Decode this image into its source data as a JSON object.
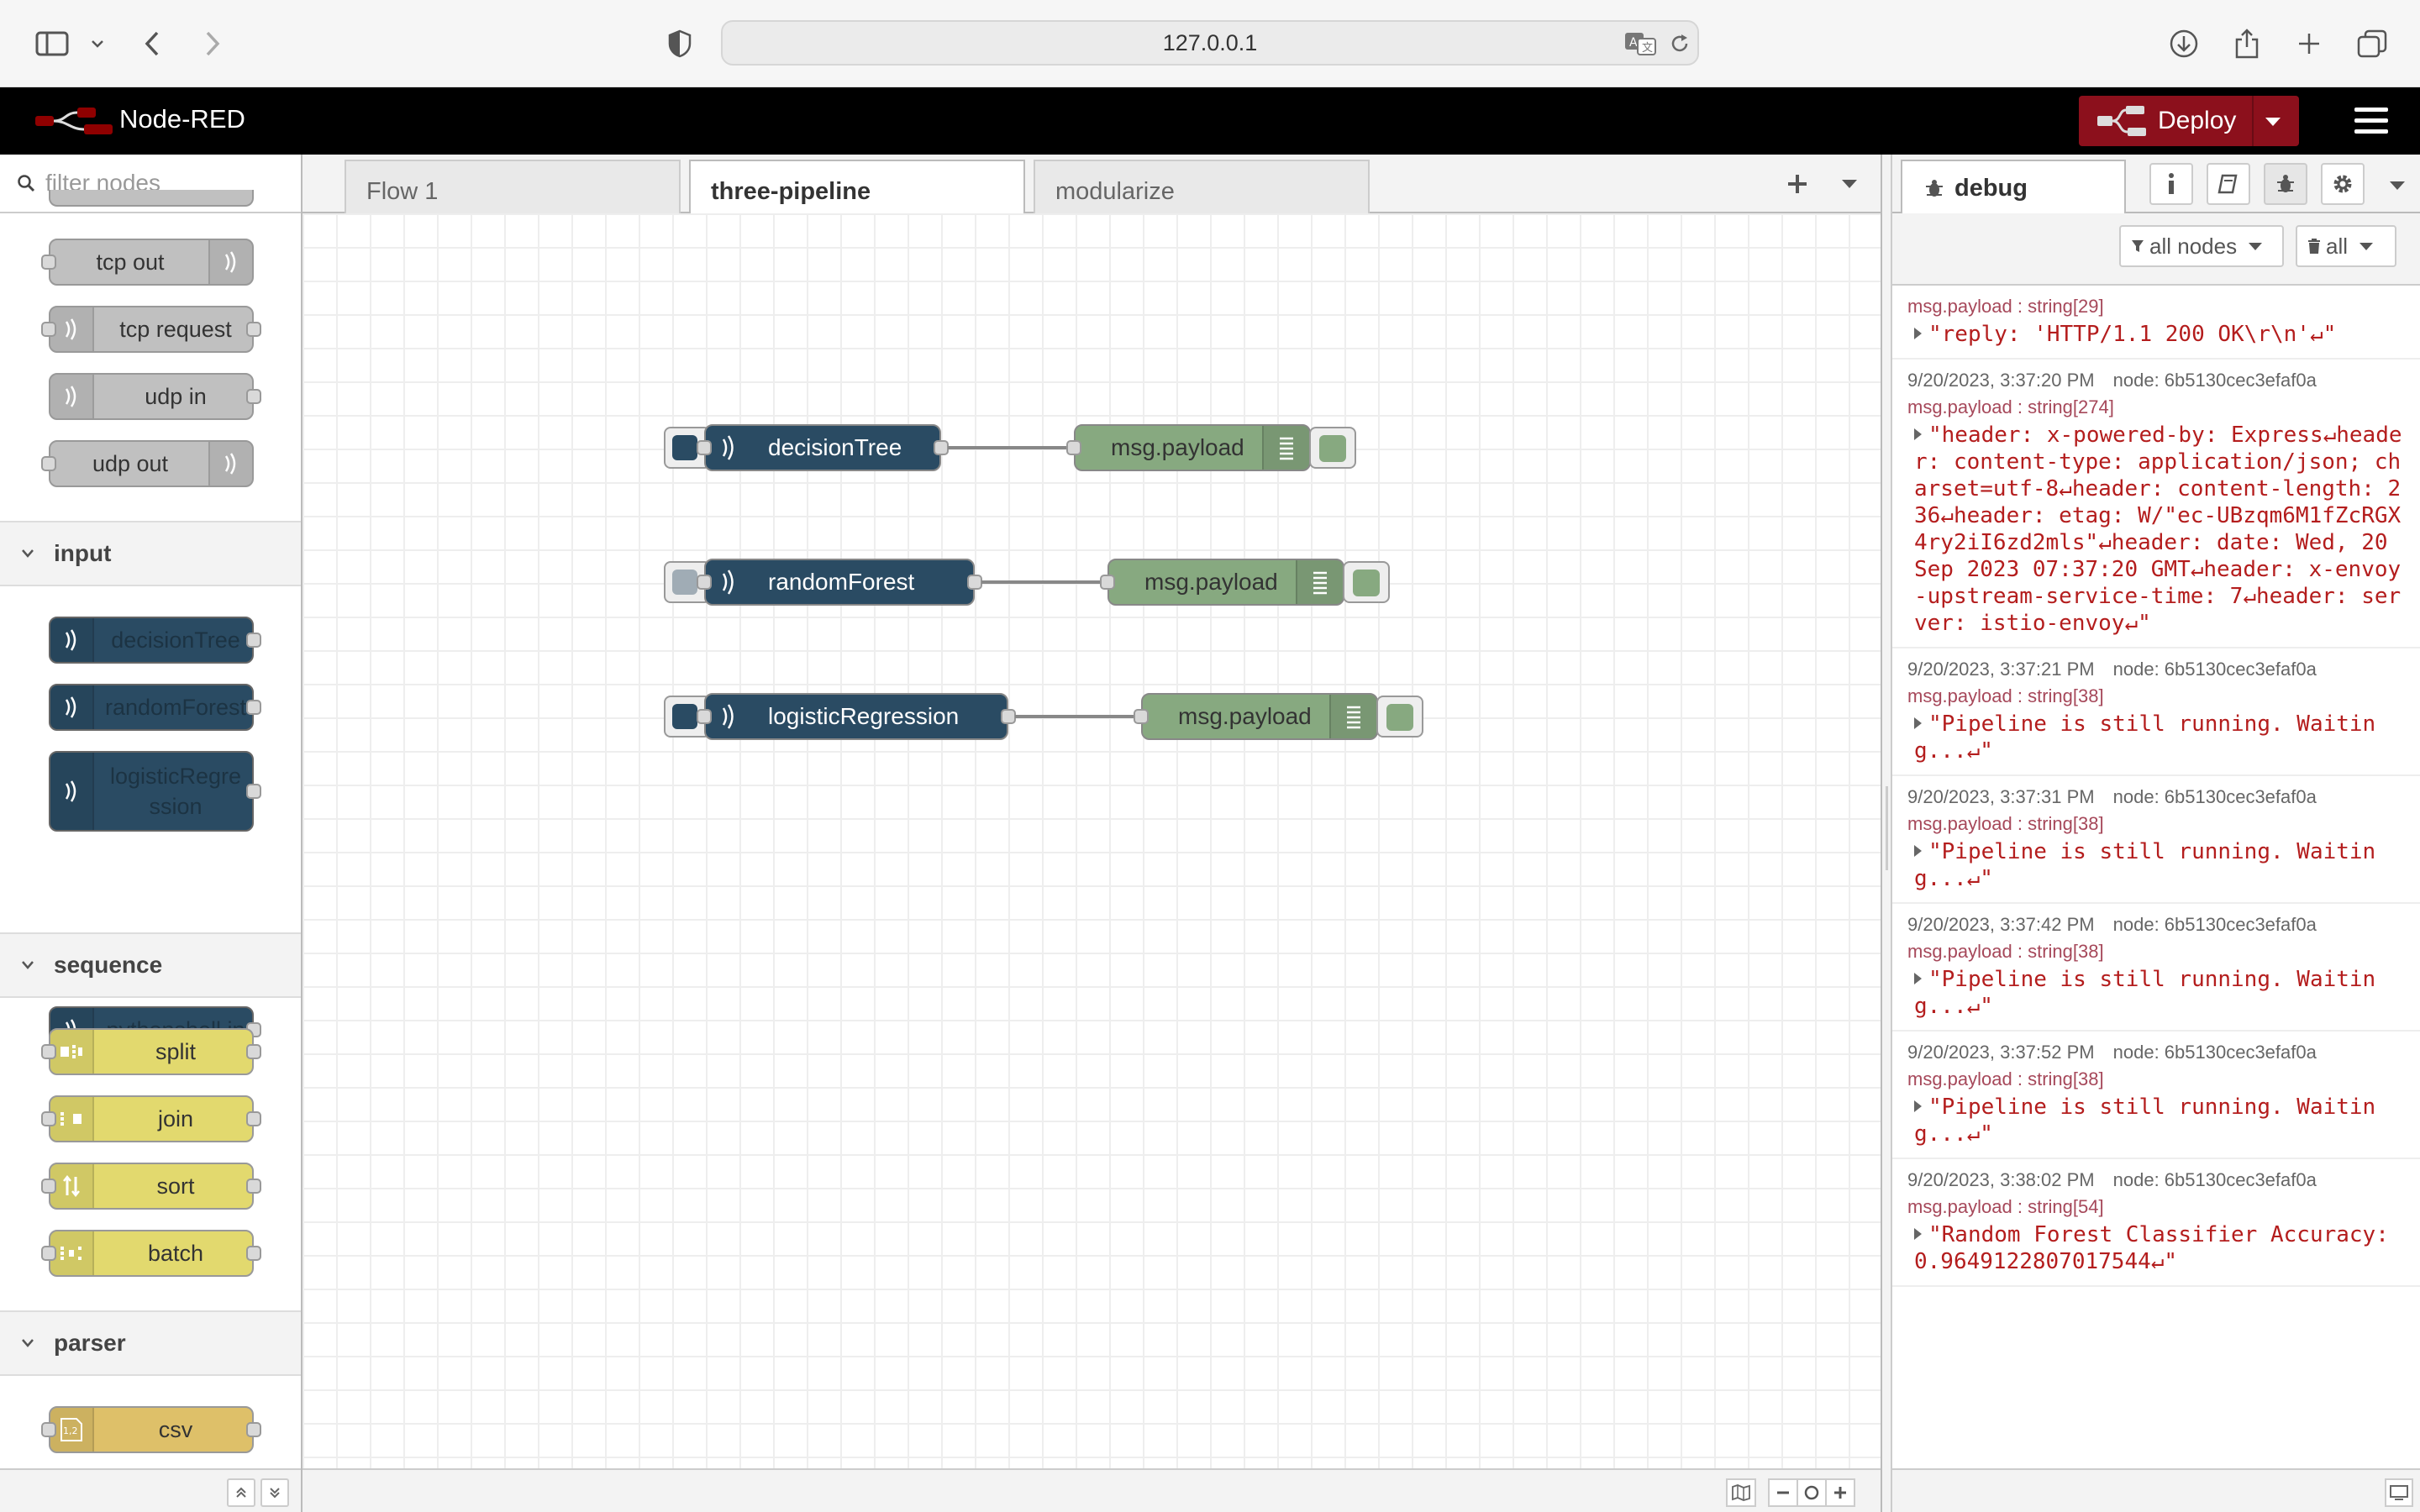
{
  "browser": {
    "url": "127.0.0.1"
  },
  "header": {
    "title": "Node-RED",
    "deploy_label": "Deploy"
  },
  "palette": {
    "search_placeholder": "filter nodes",
    "network_nodes": [
      "tcp out",
      "tcp request",
      "udp in",
      "udp out"
    ],
    "categories": {
      "input": {
        "label": "input",
        "nodes": [
          "decisionTree",
          "randomForest",
          "logisticRegre\nssion",
          "pythonshell in"
        ]
      },
      "sequence": {
        "label": "sequence",
        "nodes": [
          "split",
          "join",
          "sort",
          "batch"
        ]
      },
      "parser": {
        "label": "parser",
        "nodes": [
          "csv"
        ]
      }
    }
  },
  "workspace": {
    "tabs": [
      {
        "label": "Flow 1",
        "active": false
      },
      {
        "label": "three-pipeline",
        "active": true
      },
      {
        "label": "modularize",
        "active": false
      }
    ],
    "flows": [
      {
        "inject": "decisionTree",
        "debug": "msg.payload",
        "inject_active": true
      },
      {
        "inject": "randomForest",
        "debug": "msg.payload",
        "inject_active": false
      },
      {
        "inject": "logisticRegression",
        "debug": "msg.payload",
        "inject_active": true
      }
    ]
  },
  "sidebar": {
    "tab_label": "debug",
    "filter_nodes": "all nodes",
    "clear_label": "all",
    "messages": [
      {
        "meta": "",
        "node": "",
        "topic": "msg.payload : string[29]",
        "body": "\"reply: 'HTTP/1.1 200 OK\\r\\n'↵\""
      },
      {
        "meta": "9/20/2023, 3:37:20 PM",
        "node": "node: 6b5130cec3efaf0a",
        "topic": "msg.payload : string[274]",
        "body": "\"header: x-powered-by: Express↵header: content-type: application/json; charset=utf-8↵header: content-length: 236↵header: etag: W/\"ec-UBzqm6M1fZcRGX4ry2iI6zd2mls\"↵header: date: Wed, 20 Sep 2023 07:37:20 GMT↵header: x-envoy-upstream-service-time: 7↵header: server: istio-envoy↵\""
      },
      {
        "meta": "9/20/2023, 3:37:21 PM",
        "node": "node: 6b5130cec3efaf0a",
        "topic": "msg.payload : string[38]",
        "body": "\"Pipeline is still running. Waiting...↵\""
      },
      {
        "meta": "9/20/2023, 3:37:31 PM",
        "node": "node: 6b5130cec3efaf0a",
        "topic": "msg.payload : string[38]",
        "body": "\"Pipeline is still running. Waiting...↵\""
      },
      {
        "meta": "9/20/2023, 3:37:42 PM",
        "node": "node: 6b5130cec3efaf0a",
        "topic": "msg.payload : string[38]",
        "body": "\"Pipeline is still running. Waiting...↵\""
      },
      {
        "meta": "9/20/2023, 3:37:52 PM",
        "node": "node: 6b5130cec3efaf0a",
        "topic": "msg.payload : string[38]",
        "body": "\"Pipeline is still running. Waiting...↵\""
      },
      {
        "meta": "9/20/2023, 3:38:02 PM",
        "node": "node: 6b5130cec3efaf0a",
        "topic": "msg.payload : string[54]",
        "body": "\"Random Forest Classifier Accuracy: 0.9649122807017544↵\""
      }
    ]
  },
  "colors": {
    "header_bg": "#000000",
    "deploy_bg": "#8c101c",
    "inject_node": "#2a4b63",
    "debug_node": "#87a980",
    "function_node": "#e2d96e",
    "message_text": "#b41d1d"
  }
}
